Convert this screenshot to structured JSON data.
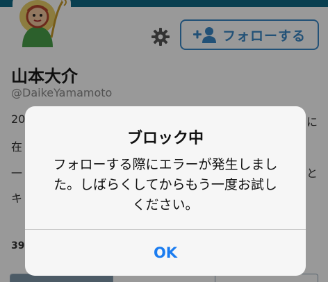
{
  "profile": {
    "name": "山本大介",
    "handle": "@DaikeYamamoto",
    "follow_button_label": "フォローする",
    "bio_lines_left": [
      "20",
      "在",
      "一",
      "キ"
    ],
    "bio_lines_right": [
      "に",
      "と"
    ],
    "stat_partial": "39",
    "colors": {
      "banner": "#0f6a86",
      "accent": "#3a88c6",
      "tab_active": "#7f98ab"
    },
    "icons": {
      "settings": "gear-icon",
      "follow": "add-user-icon"
    }
  },
  "alert": {
    "title": "ブロック中",
    "message_lines": [
      "フォローする際にエラーが発生しまし",
      "た。しばらくしてからもう一度お試し",
      "ください。"
    ],
    "ok_label": "OK",
    "colors": {
      "ok": "#1a7cf0"
    }
  }
}
